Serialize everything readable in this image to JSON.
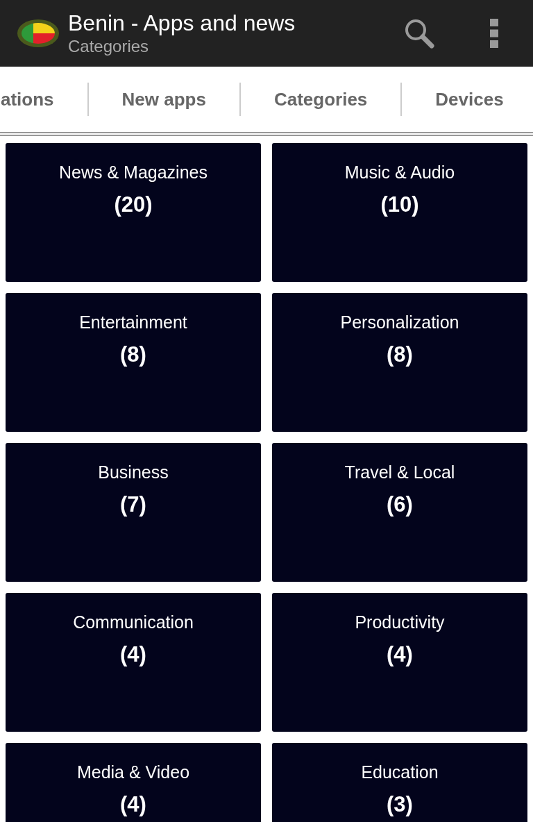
{
  "app_bar": {
    "title": "Benin - Apps and news",
    "subtitle": "Categories"
  },
  "tabs": [
    {
      "label": "ations"
    },
    {
      "label": "New apps"
    },
    {
      "label": "Categories"
    },
    {
      "label": "Devices"
    }
  ],
  "categories": [
    {
      "name": "News & Magazines",
      "count": "(20)"
    },
    {
      "name": "Music & Audio",
      "count": "(10)"
    },
    {
      "name": "Entertainment",
      "count": "(8)"
    },
    {
      "name": "Personalization",
      "count": "(8)"
    },
    {
      "name": "Business",
      "count": "(7)"
    },
    {
      "name": "Travel & Local",
      "count": "(6)"
    },
    {
      "name": "Communication",
      "count": "(4)"
    },
    {
      "name": "Productivity",
      "count": "(4)"
    },
    {
      "name": "Media & Video",
      "count": "(4)"
    },
    {
      "name": "Education",
      "count": "(3)"
    }
  ]
}
